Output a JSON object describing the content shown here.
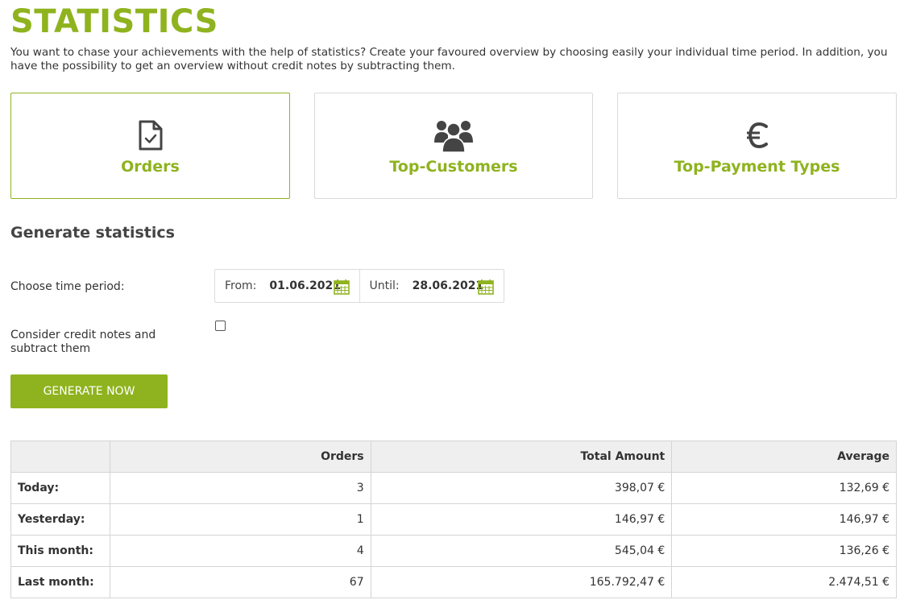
{
  "page": {
    "title": "STATISTICS",
    "intro": "You want to chase your achievements with the help of statistics? Create your favoured overview by choosing easily your individual time period. In addition, you have the possibility to get an overview without credit notes by subtracting them."
  },
  "tiles": [
    {
      "label": "Orders",
      "icon": "document-check-icon",
      "active": true
    },
    {
      "label": "Top-Customers",
      "icon": "users-icon",
      "active": false
    },
    {
      "label": "Top-Payment Types",
      "icon": "euro-icon",
      "active": false
    }
  ],
  "generate": {
    "section_title": "Generate statistics",
    "period_label": "Choose time period:",
    "from_label": "From:",
    "from_value": "01.06.2021",
    "until_label": "Until:",
    "until_value": "28.06.2021",
    "credit_label": "Consider credit notes and subtract them",
    "credit_checked": false,
    "button_label": "GENERATE NOW"
  },
  "table": {
    "headers": [
      "",
      "Orders",
      "Total Amount",
      "Average"
    ],
    "rows": [
      {
        "label": "Today:",
        "orders": "3",
        "total": "398,07 €",
        "average": "132,69 €"
      },
      {
        "label": "Yesterday:",
        "orders": "1",
        "total": "146,97 €",
        "average": "146,97 €"
      },
      {
        "label": "This month:",
        "orders": "4",
        "total": "545,04 €",
        "average": "136,26 €"
      },
      {
        "label": "Last month:",
        "orders": "67",
        "total": "165.792,47 €",
        "average": "2.474,51 €"
      }
    ]
  },
  "colors": {
    "accent": "#8fb31e",
    "icon": "#444444",
    "header_bg": "#efefef"
  }
}
